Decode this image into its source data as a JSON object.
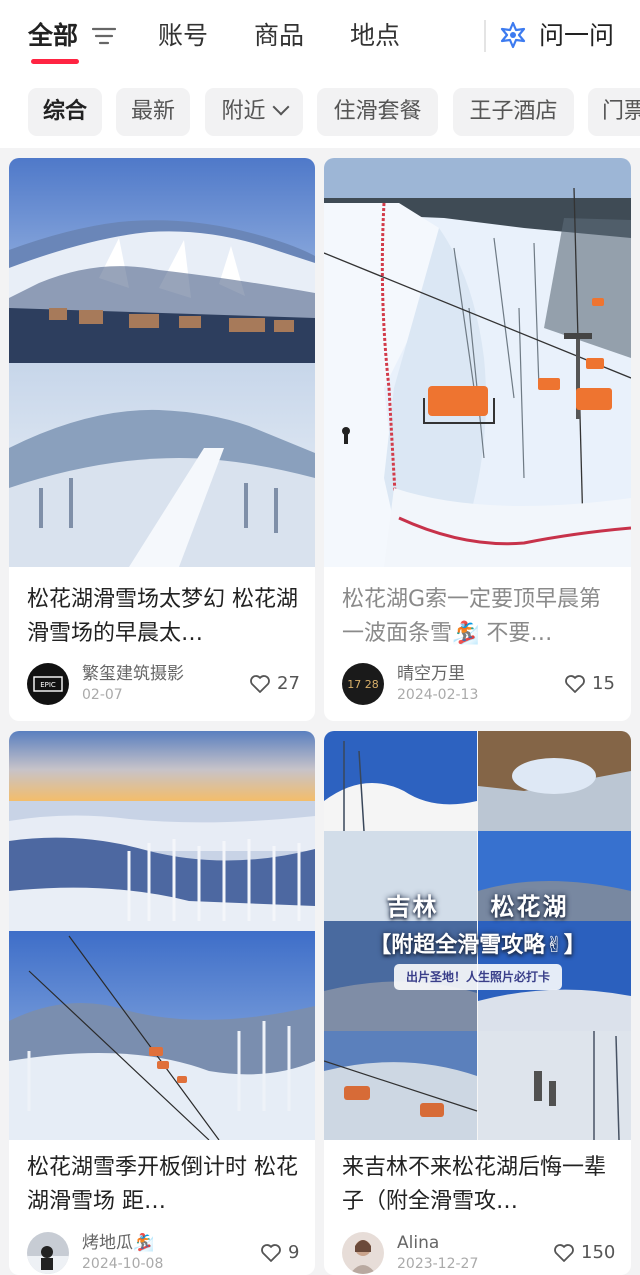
{
  "tabs": [
    {
      "label": "全部",
      "active": true
    },
    {
      "label": "账号"
    },
    {
      "label": "商品"
    },
    {
      "label": "地点"
    }
  ],
  "ask_label": "问一问",
  "chips": [
    {
      "label": "综合",
      "active": true
    },
    {
      "label": "最新"
    },
    {
      "label": "附近",
      "dropdown": true
    },
    {
      "label": "住滑套餐"
    },
    {
      "label": "王子酒店"
    },
    {
      "label": "门票"
    }
  ],
  "cards": [
    {
      "title": "松花湖滑雪场太梦幻 松花湖滑雪场的早晨太…",
      "author": "繁玺建筑摄影",
      "date": "02-07",
      "likes": "27",
      "avatar_text": "EPIC"
    },
    {
      "title": "松花湖G索一定要顶早晨第一波面条雪🏂 不要…",
      "author": "晴空万里",
      "date": "2024-02-13",
      "likes": "15",
      "avatar_text": "17 28"
    },
    {
      "title": "松花湖雪季开板倒计时 松花湖滑雪场 距…",
      "author": "烤地瓜🏂",
      "date": "2024-10-08",
      "likes": "9"
    },
    {
      "title": "来吉林不来松花湖后悔一辈子（附全滑雪攻…",
      "author": "Alina",
      "date": "2023-12-27",
      "likes": "150",
      "overlay": {
        "line1_left": "吉林",
        "line1_right": "松花湖",
        "line2": "【附超全滑雪攻略✌】",
        "line3": "出片圣地！人生照片必打卡"
      }
    }
  ],
  "colors": {
    "accent": "#ff2442",
    "ask_icon": "#3d7bf0",
    "background": "#f3f3f4"
  },
  "icons": [
    "filter-icon",
    "ask-star-icon",
    "heart-outline-icon",
    "chevron-down-icon"
  ]
}
